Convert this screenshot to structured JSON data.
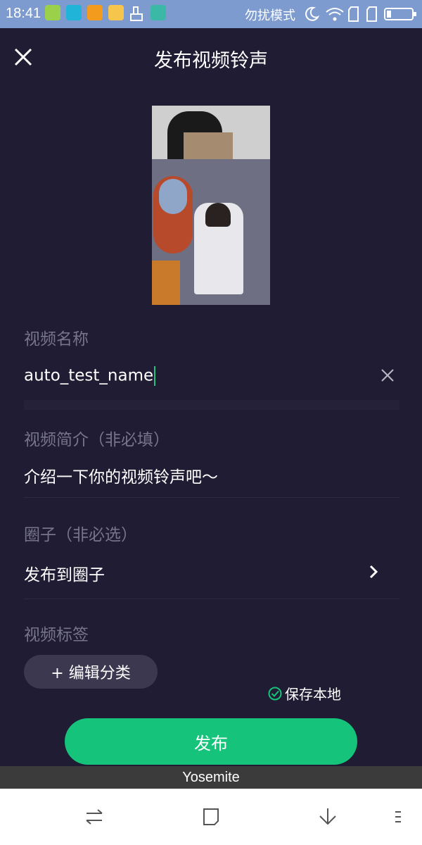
{
  "status_bar": {
    "time": "18:41",
    "dnd_text": "勿扰模式",
    "app_icon_colors": [
      "#9bd14a",
      "#1fb4d8",
      "#f29b1d",
      "#f6c54c"
    ]
  },
  "header": {
    "title": "发布视频铃声",
    "close_icon": "close-icon"
  },
  "form": {
    "name_label": "视频名称",
    "name_value": "auto_test_name",
    "intro_label": "视频简介（非必填）",
    "intro_placeholder": "介绍一下你的视频铃声吧～",
    "circle_label": "圈子（非必选）",
    "circle_value": "发布到圈子",
    "tag_label": "视频标签",
    "edit_category": "+ 编辑分类",
    "save_local": "保存本地"
  },
  "actions": {
    "publish": "发布"
  },
  "ime_bar": {
    "text": "Yosemite"
  },
  "colors": {
    "background": "#1f1c33",
    "accent": "#15c47a",
    "muted_text": "#77758a"
  }
}
